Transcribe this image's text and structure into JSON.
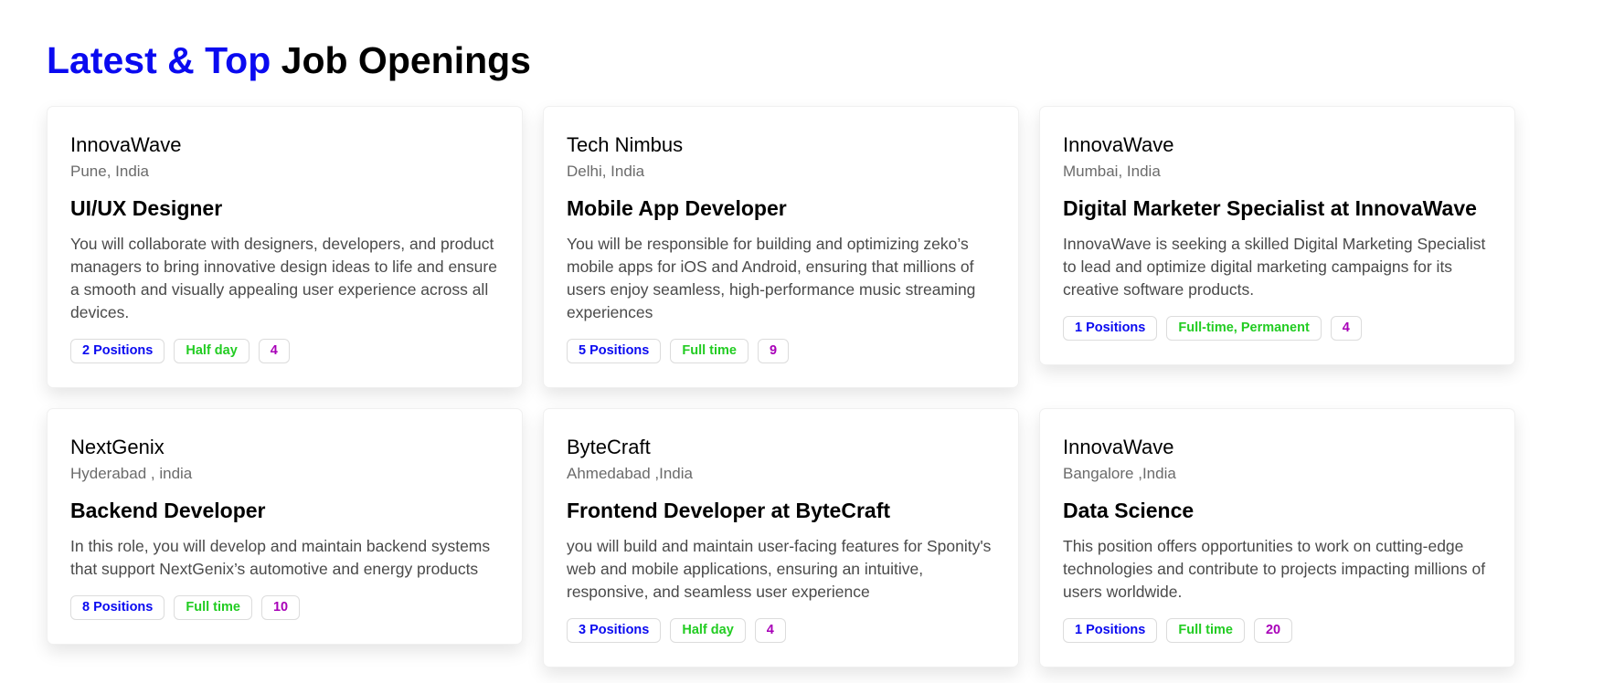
{
  "header": {
    "title_accent": "Latest & Top",
    "title_rest": " Job Openings"
  },
  "colors": {
    "accent": "#0a0af0",
    "type": "#22cc22",
    "count": "#a800b8"
  },
  "jobs": [
    {
      "company": "InnovaWave",
      "location": "Pune, India",
      "title": "UI/UX Designer",
      "description": "You will collaborate with designers, developers, and product managers to bring innovative design ideas to life and ensure a smooth and visually appealing user experience across all devices.",
      "positions": "2 Positions",
      "type": "Half day",
      "count": "4"
    },
    {
      "company": "Tech Nimbus",
      "location": "Delhi, India",
      "title": "Mobile App Developer",
      "description": "You will be responsible for building and optimizing zeko’s mobile apps for iOS and Android, ensuring that millions of users enjoy seamless, high-performance music streaming experiences",
      "positions": "5 Positions",
      "type": "Full time",
      "count": "9"
    },
    {
      "company": "InnovaWave",
      "location": "Mumbai, India",
      "title": "Digital Marketer Specialist at InnovaWave",
      "description": "InnovaWave is seeking a skilled Digital Marketing Specialist to lead and optimize digital marketing campaigns for its creative software products.",
      "positions": "1 Positions",
      "type": "Full-time, Permanent",
      "count": "4"
    },
    {
      "company": "NextGenix",
      "location": "Hyderabad , india",
      "title": "Backend Developer",
      "description": "In this role, you will develop and maintain backend systems that support NextGenix’s automotive and energy products",
      "positions": "8 Positions",
      "type": "Full time",
      "count": "10"
    },
    {
      "company": "ByteCraft",
      "location": "Ahmedabad ,India",
      "title": "Frontend Developer at ByteCraft",
      "description": "you will build and maintain user-facing features for Sponity's web and mobile applications, ensuring an intuitive, responsive, and seamless user experience",
      "positions": "3 Positions",
      "type": "Half day",
      "count": "4"
    },
    {
      "company": "InnovaWave",
      "location": "Bangalore ,India",
      "title": "Data Science",
      "description": "This position offers opportunities to work on cutting-edge technologies and contribute to projects impacting millions of users worldwide.",
      "positions": "1 Positions",
      "type": "Full time",
      "count": "20"
    }
  ]
}
